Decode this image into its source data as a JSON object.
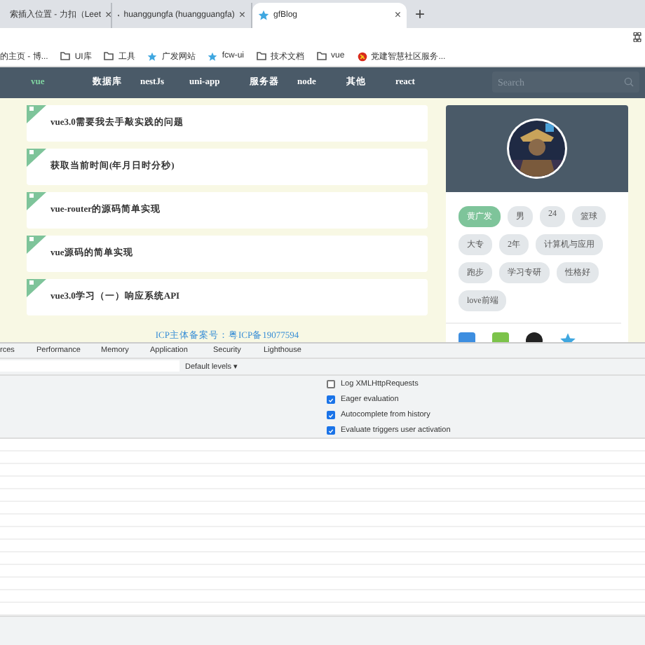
{
  "browser_tabs": [
    {
      "title": "索插入位置 - 力扣（Leet",
      "close": "×",
      "selected": false
    },
    {
      "title": "huanggungfa (huangguangfa)",
      "close": "×",
      "selected": false
    },
    {
      "title": "gfBlog",
      "close": "×",
      "selected": true
    }
  ],
  "new_tab": "+",
  "bookmarks": [
    {
      "label": "的主页 - 博..."
    },
    {
      "label": "UI库"
    },
    {
      "label": "工具"
    },
    {
      "label": "广发网站"
    },
    {
      "label": "fcw-ui"
    },
    {
      "label": "技术文档"
    },
    {
      "label": "vue"
    },
    {
      "label": "党建智慧社区服务..."
    }
  ],
  "site_nav": {
    "items": [
      {
        "label": "vue",
        "selected": true
      },
      {
        "label": "数据库",
        "selected": false
      },
      {
        "label": "nestJs",
        "selected": false
      },
      {
        "label": "uni-app",
        "selected": false
      },
      {
        "label": "服务器",
        "selected": false
      },
      {
        "label": "node",
        "selected": false
      },
      {
        "label": "其他",
        "selected": false
      },
      {
        "label": "react",
        "selected": false
      }
    ],
    "search": {
      "placeholder": "Search"
    }
  },
  "posts": [
    {
      "title": "vue3.0需要我去手敲实践的问题"
    },
    {
      "title": "获取当前时间(年月日时分秒)"
    },
    {
      "title": "vue-router的源码简单实现"
    },
    {
      "title": "vue源码的简单实现"
    },
    {
      "title": "vue3.0学习（一）响应系统API"
    }
  ],
  "footer": "ICP主体备案号：粤ICP备19077594",
  "profile": {
    "tags": [
      {
        "label": "黄广发",
        "selected": true
      },
      {
        "label": "男",
        "selected": false
      },
      {
        "label": "24",
        "selected": false
      },
      {
        "label": "篮球",
        "selected": false
      },
      {
        "label": "大专",
        "selected": false
      },
      {
        "label": "2年",
        "selected": false
      },
      {
        "label": "计算机与应用",
        "selected": false
      },
      {
        "label": "跑步",
        "selected": false
      },
      {
        "label": "学习专研",
        "selected": false
      },
      {
        "label": "性格好",
        "selected": false
      },
      {
        "label": "love前端",
        "selected": false
      }
    ]
  },
  "devtools": {
    "tabs": [
      {
        "label": "rces",
        "selected": false
      },
      {
        "label": "Performance",
        "selected": false
      },
      {
        "label": "Memory",
        "selected": false
      },
      {
        "label": "Application",
        "selected": false
      },
      {
        "label": "Security",
        "selected": false
      },
      {
        "label": "Lighthouse",
        "selected": false
      }
    ],
    "levels": "Default levels ▾",
    "settings": [
      {
        "label": "Log XMLHttpRequests",
        "checked": false
      },
      {
        "label": "Eager evaluation",
        "checked": true
      },
      {
        "label": "Autocomplete from history",
        "checked": true
      },
      {
        "label": "Evaluate triggers user activation",
        "checked": true
      }
    ]
  }
}
